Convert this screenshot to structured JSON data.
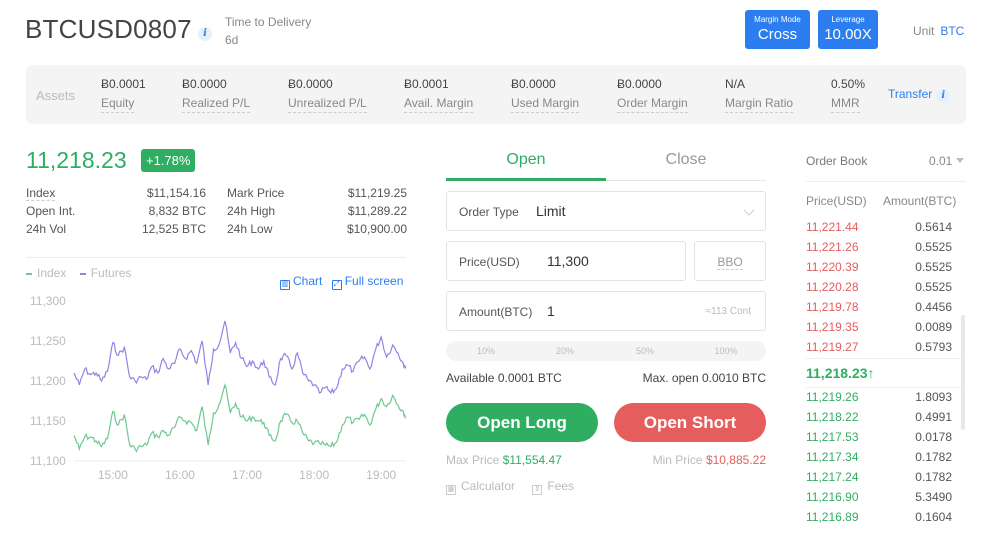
{
  "header": {
    "symbol": "BTCUSD0807",
    "info_icon": "i",
    "delivery_label": "Time to Delivery",
    "delivery_value": "6d",
    "margin_mode_label": "Margin Mode",
    "margin_mode_value": "Cross",
    "leverage_label": "Leverage",
    "leverage_value": "10.00X",
    "unit_label": "Unit",
    "unit_value": "BTC"
  },
  "assets": {
    "title": "Assets",
    "items": [
      {
        "value": "Ƀ0.0001",
        "label": "Equity"
      },
      {
        "value": "Ƀ0.0000",
        "label": "Realized P/L"
      },
      {
        "value": "Ƀ0.0000",
        "label": "Unrealized P/L"
      },
      {
        "value": "Ƀ0.0001",
        "label": "Avail. Margin"
      },
      {
        "value": "Ƀ0.0000",
        "label": "Used Margin"
      },
      {
        "value": "Ƀ0.0000",
        "label": "Order Margin"
      },
      {
        "value": "N/A",
        "label": "Margin Ratio"
      },
      {
        "value": "0.50%",
        "label": "MMR"
      }
    ],
    "transfer_label": "Transfer"
  },
  "ticker": {
    "last_price": "11,218.23",
    "change": "+1.78%",
    "stats": [
      {
        "label": "Index",
        "value": "$11,154.16"
      },
      {
        "label": "Open Int.",
        "value": "8,832 BTC"
      },
      {
        "label": "24h Vol",
        "value": "12,525 BTC"
      },
      {
        "label": "Mark Price",
        "value": "$11,219.25"
      },
      {
        "label": "24h High",
        "value": "$11,289.22"
      },
      {
        "label": "24h Low",
        "value": "$10,900.00"
      }
    ]
  },
  "chart_links": {
    "chart": "Chart",
    "fullscreen": "Full screen",
    "chart_icon": "candlestick-icon",
    "fullscreen_icon": "expand-icon"
  },
  "chart_data": {
    "type": "line",
    "title": "",
    "xlabel": "",
    "ylabel": "",
    "x_ticks": [
      "15:00",
      "16:00",
      "17:00",
      "18:00",
      "19:00"
    ],
    "y_ticks": [
      "11,100",
      "11,150",
      "11,200",
      "11,250",
      "11,300"
    ],
    "ylim": [
      11100,
      11300
    ],
    "xlim_hours": [
      14.42,
      19.37
    ],
    "grid": false,
    "legend": "top-left",
    "x": [
      14.42,
      14.5,
      14.58,
      14.67,
      14.75,
      14.83,
      14.92,
      15.0,
      15.08,
      15.17,
      15.25,
      15.33,
      15.42,
      15.5,
      15.58,
      15.67,
      15.75,
      15.83,
      15.92,
      16.0,
      16.08,
      16.17,
      16.25,
      16.33,
      16.42,
      16.5,
      16.58,
      16.67,
      16.75,
      16.83,
      16.92,
      17.0,
      17.08,
      17.17,
      17.25,
      17.33,
      17.42,
      17.5,
      17.58,
      17.67,
      17.75,
      17.83,
      17.92,
      18.0,
      18.08,
      18.17,
      18.25,
      18.33,
      18.42,
      18.5,
      18.58,
      18.67,
      18.75,
      18.83,
      18.92,
      19.0,
      19.08,
      19.17,
      19.25,
      19.33,
      19.37
    ],
    "series": [
      {
        "name": "Futures",
        "color": "#8f85e6",
        "values": [
          11210,
          11195,
          11215,
          11208,
          11210,
          11200,
          11212,
          11248,
          11232,
          11242,
          11205,
          11200,
          11205,
          11202,
          11218,
          11210,
          11228,
          11215,
          11222,
          11240,
          11228,
          11238,
          11222,
          11250,
          11195,
          11240,
          11245,
          11275,
          11235,
          11248,
          11228,
          11218,
          11225,
          11215,
          11225,
          11205,
          11195,
          11228,
          11232,
          11215,
          11235,
          11210,
          11200,
          11195,
          11185,
          11192,
          11185,
          11190,
          11215,
          11220,
          11212,
          11225,
          11230,
          11215,
          11240,
          11255,
          11230,
          11245,
          11235,
          11222,
          11218
        ]
      },
      {
        "name": "Index",
        "color": "#6cc98f",
        "values": [
          11132,
          11115,
          11130,
          11130,
          11125,
          11118,
          11128,
          11162,
          11145,
          11158,
          11120,
          11115,
          11118,
          11120,
          11135,
          11130,
          11138,
          11132,
          11142,
          11155,
          11150,
          11148,
          11138,
          11168,
          11120,
          11160,
          11170,
          11195,
          11160,
          11172,
          11155,
          11150,
          11155,
          11150,
          11148,
          11132,
          11125,
          11150,
          11158,
          11148,
          11150,
          11135,
          11125,
          11122,
          11122,
          11120,
          11118,
          11123,
          11145,
          11155,
          11148,
          11152,
          11158,
          11145,
          11165,
          11178,
          11168,
          11182,
          11170,
          11162,
          11155
        ]
      }
    ]
  },
  "order_form": {
    "tabs": [
      "Open",
      "Close"
    ],
    "active_tab": "Open",
    "order_type_label": "Order Type",
    "order_type_value": "Limit",
    "price_label": "Price(USD)",
    "price_value": "11,300",
    "bbo_label": "BBO",
    "amount_label": "Amount(BTC)",
    "amount_value": "1",
    "contracts_hint": "≈113 Cont",
    "percent_options": [
      "10%",
      "20%",
      "50%",
      "100%"
    ],
    "available": "Available 0.0001 BTC",
    "max_open": "Max. open 0.0010 BTC",
    "open_long": "Open Long",
    "open_short": "Open Short",
    "max_price_label": "Max Price",
    "max_price_value": "$11,554.47",
    "min_price_label": "Min Price",
    "min_price_value": "$10,885.22",
    "calculator_label": "Calculator",
    "fees_label": "Fees"
  },
  "order_book": {
    "title": "Order Book",
    "precision": "0.01",
    "col_price": "Price(USD)",
    "col_amount": "Amount(BTC)",
    "asks": [
      {
        "price": "11,221.44",
        "amount": "0.5614"
      },
      {
        "price": "11,221.26",
        "amount": "0.5525"
      },
      {
        "price": "11,220.39",
        "amount": "0.5525"
      },
      {
        "price": "11,220.28",
        "amount": "0.5525"
      },
      {
        "price": "11,219.78",
        "amount": "0.4456"
      },
      {
        "price": "11,219.35",
        "amount": "0.0089"
      },
      {
        "price": "11,219.27",
        "amount": "0.5793"
      }
    ],
    "last_price": "11,218.23",
    "last_arrow": "↑",
    "bids": [
      {
        "price": "11,219.26",
        "amount": "1.8093"
      },
      {
        "price": "11,218.22",
        "amount": "0.4991"
      },
      {
        "price": "11,217.53",
        "amount": "0.0178"
      },
      {
        "price": "11,217.34",
        "amount": "0.1782"
      },
      {
        "price": "11,217.24",
        "amount": "0.1782"
      },
      {
        "price": "11,216.90",
        "amount": "5.3490"
      },
      {
        "price": "11,216.89",
        "amount": "0.1604"
      }
    ]
  },
  "colors": {
    "accent_blue": "#2c7ef0",
    "buy_green": "#2fae62",
    "sell_red": "#e55d5d",
    "futures_line": "#8f85e6",
    "index_line": "#6cc98f"
  }
}
